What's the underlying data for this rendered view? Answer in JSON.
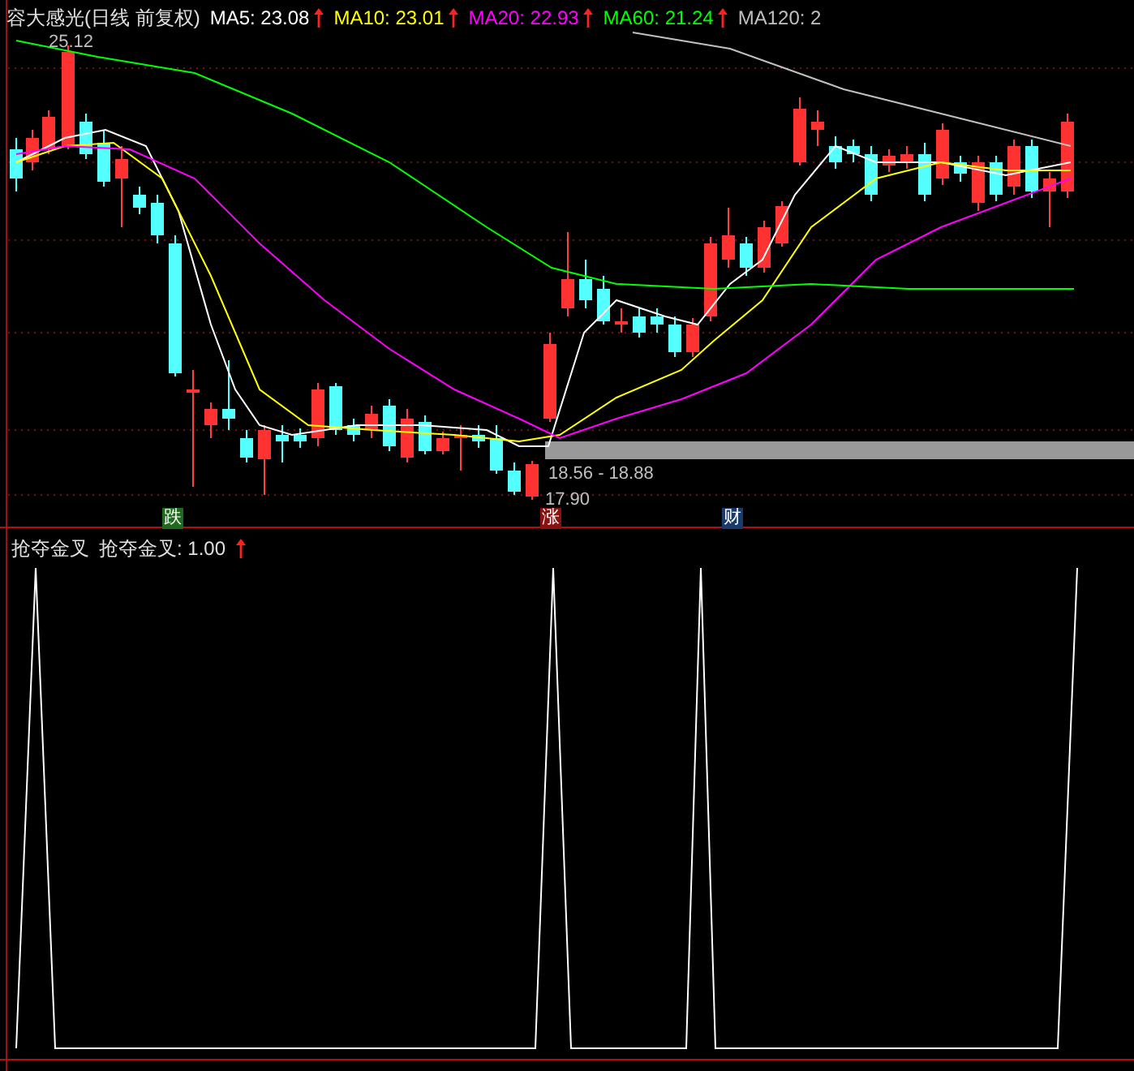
{
  "header": {
    "title": "容大感光(日线 前复权)",
    "indicators": [
      {
        "label": "MA5: 23.08",
        "color": "#ffffff",
        "arrow": true
      },
      {
        "label": "MA10: 23.01",
        "color": "#ffff00",
        "arrow": true
      },
      {
        "label": "MA20: 22.93",
        "color": "#ff00ff",
        "arrow": true
      },
      {
        "label": "MA60: 21.24",
        "color": "#00ff00",
        "arrow": true
      },
      {
        "label": "MA120: 2",
        "color": "#c0c0c0",
        "arrow": false
      }
    ]
  },
  "price_labels": [
    {
      "kind": "high",
      "text": "25.12"
    },
    {
      "kind": "range",
      "text": "18.56 - 18.88"
    },
    {
      "kind": "low",
      "text": "17.90"
    }
  ],
  "tags": [
    {
      "text": "跌",
      "color": "#1e6b1e"
    },
    {
      "text": "涨",
      "color": "#8b1010"
    },
    {
      "text": "财",
      "color": "#1a3a6b"
    }
  ],
  "indicator_panel": {
    "name": "抢夺金叉",
    "reading": "抢夺金叉: 1.00",
    "arrow": true
  }
}
